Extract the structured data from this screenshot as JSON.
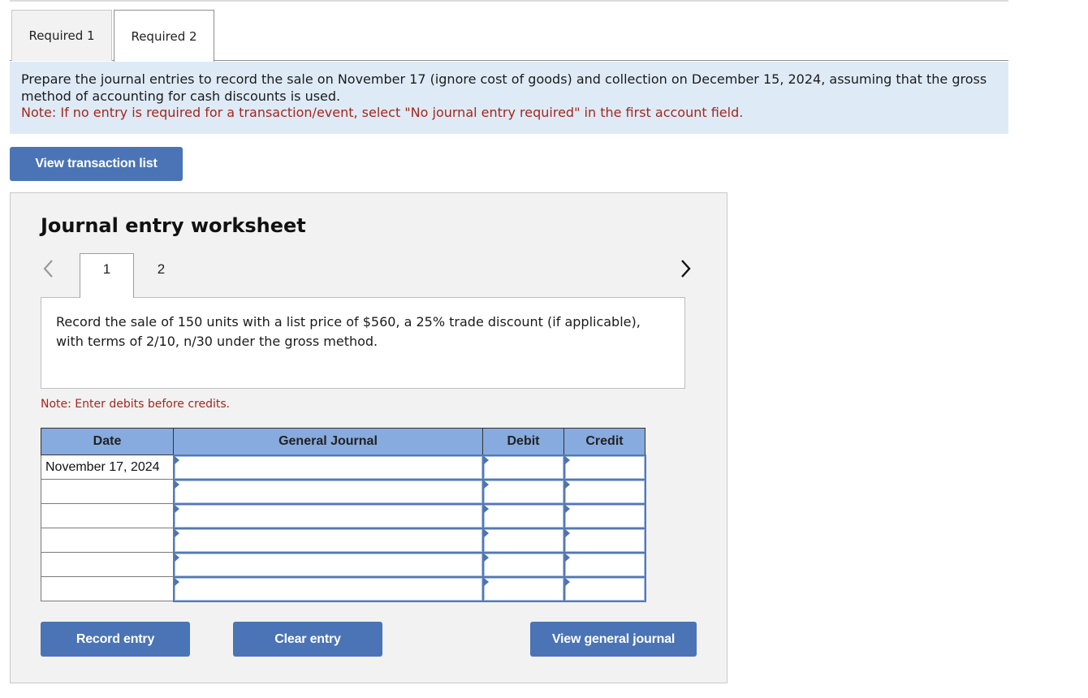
{
  "required_tabs": [
    {
      "label": "Required 1",
      "active": false
    },
    {
      "label": "Required 2",
      "active": true
    }
  ],
  "instructions": {
    "main": "Prepare the journal entries to record the sale on November 17 (ignore cost of goods) and collection on December 15, 2024, assuming that the gross method of accounting for cash discounts is used.",
    "note": "Note: If no entry is required for a transaction/event, select \"No journal entry required\" in the first account field."
  },
  "buttons": {
    "view_transaction_list": "View transaction list",
    "record_entry": "Record entry",
    "clear_entry": "Clear entry",
    "view_general_journal": "View general journal"
  },
  "worksheet": {
    "title": "Journal entry worksheet",
    "entry_tabs": [
      {
        "label": "1",
        "active": true
      },
      {
        "label": "2",
        "active": false
      }
    ],
    "nav": {
      "prev_icon": "chevron-left-icon",
      "next_icon": "chevron-right-icon"
    },
    "description": "Record the sale of 150 units with a list price of $560, a 25% trade discount (if applicable), with terms of 2/10, n/30 under the gross method.",
    "note": "Note: Enter debits before credits."
  },
  "journal_table": {
    "headers": {
      "date": "Date",
      "general_journal": "General Journal",
      "debit": "Debit",
      "credit": "Credit"
    },
    "rows": [
      {
        "date": "November 17, 2024",
        "account": "",
        "debit": "",
        "credit": ""
      },
      {
        "date": "",
        "account": "",
        "debit": "",
        "credit": ""
      },
      {
        "date": "",
        "account": "",
        "debit": "",
        "credit": ""
      },
      {
        "date": "",
        "account": "",
        "debit": "",
        "credit": ""
      },
      {
        "date": "",
        "account": "",
        "debit": "",
        "credit": ""
      },
      {
        "date": "",
        "account": "",
        "debit": "",
        "credit": ""
      }
    ]
  },
  "colors": {
    "accent_button": "#4a74b5",
    "instruction_bg": "#deebf7",
    "note_red": "#a8251c",
    "table_header": "#87aadf"
  }
}
